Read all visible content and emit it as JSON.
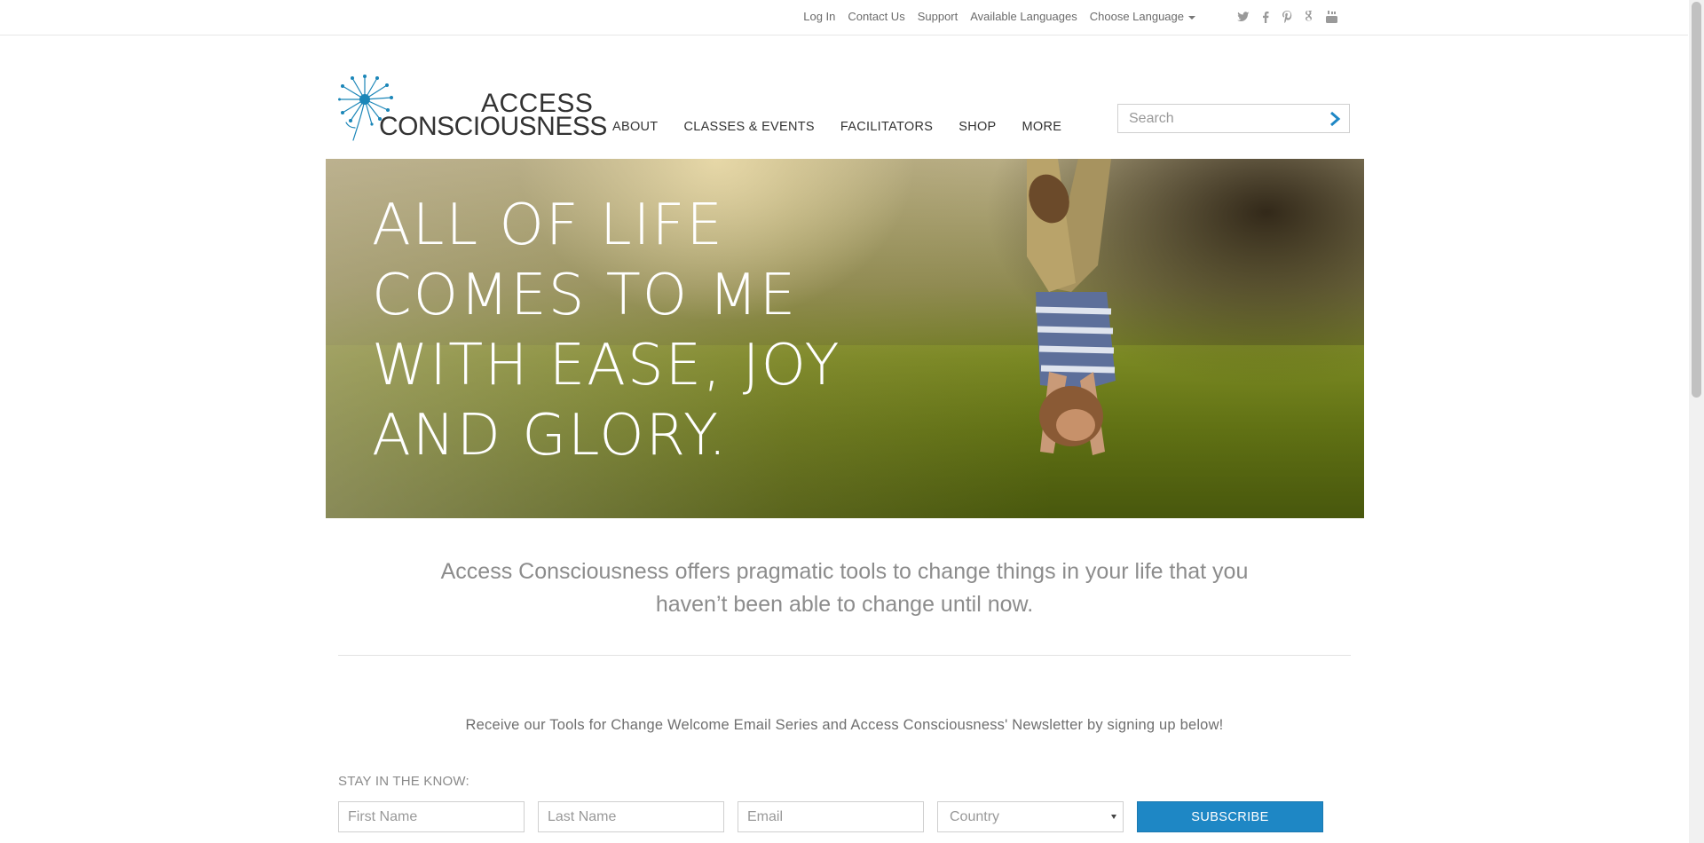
{
  "topbar": {
    "links": [
      "Log In",
      "Contact Us",
      "Support",
      "Available Languages"
    ],
    "language_label": "Choose Language"
  },
  "social_icons": [
    "twitter-icon",
    "facebook-icon",
    "pinterest-icon",
    "google-plus-icon",
    "youtube-icon"
  ],
  "logo": {
    "line1": "ACCESS",
    "line2": "CONSCIOUSNESS"
  },
  "nav": {
    "items": [
      "ABOUT",
      "CLASSES & EVENTS",
      "FACILITATORS",
      "SHOP",
      "MORE"
    ]
  },
  "search": {
    "placeholder": "Search"
  },
  "hero": {
    "lines": [
      "ALL OF LIFE",
      "COMES TO ME",
      "WITH EASE, JOY",
      "AND GLORY."
    ]
  },
  "intro": {
    "text": "Access Consciousness offers pragmatic tools to change things in your life that you haven’t been able to change until now."
  },
  "signup": {
    "text": "Receive our Tools for Change Welcome Email Series and Access Consciousness' Newsletter by signing up below!",
    "heading": "STAY IN THE KNOW:",
    "first_name_placeholder": "First Name",
    "last_name_placeholder": "Last Name",
    "email_placeholder": "Email",
    "country_selected": "Country",
    "subscribe_label": "SUBSCRIBE"
  },
  "colors": {
    "accent": "#1e87c5",
    "logo_blue": "#1b86b8",
    "text_gray": "#8c8c8c"
  }
}
